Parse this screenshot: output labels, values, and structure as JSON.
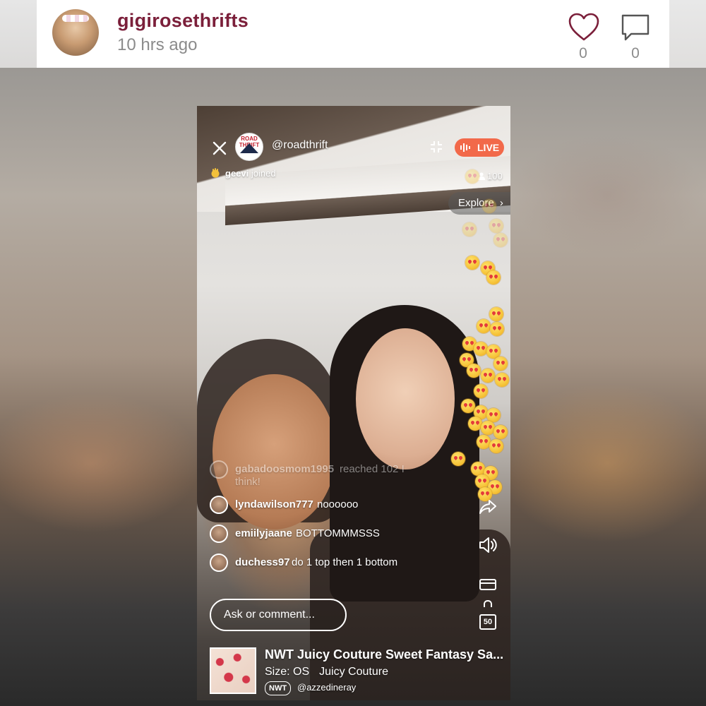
{
  "header": {
    "username": "gigirosethrifts",
    "timestamp": "10 hrs ago",
    "like_count": "0",
    "comment_count": "0"
  },
  "stream": {
    "channel_name": "@roadthrift",
    "channel_logo_text": "ROAD THRIFT",
    "live_label": "LIVE",
    "join_user": "geevi",
    "join_text": "joined",
    "viewer_count": "100",
    "explore_label": "Explore",
    "comments": [
      {
        "user": "gabadoosmom1995",
        "msg": "reached 102 I",
        "msg2": "think!",
        "faded": true
      },
      {
        "user": "lyndawilson777",
        "msg": "noooooo"
      },
      {
        "user": "emiilyjaane",
        "msg": "BOTTOMMMSSS"
      },
      {
        "user": "duchess97",
        "msg": "do 1 top then 1 bottom"
      }
    ],
    "ask_placeholder": "Ask or comment...",
    "listing_count": "50",
    "product": {
      "title": "NWT Juicy Couture Sweet Fantasy Sa...",
      "size": "Size: OS",
      "brand": "Juicy Couture",
      "badge": "NWT",
      "seller": "@azzedineray"
    }
  },
  "icons": [
    "heart-icon",
    "comment-icon",
    "close-icon",
    "collapse-icon",
    "live-bars-icon",
    "wave-icon",
    "person-icon",
    "chevron-right-icon",
    "share-icon",
    "speaker-icon",
    "card-icon",
    "bag-icon"
  ],
  "colors": {
    "username": "#7b1f3a",
    "live_badge": "#f2694a",
    "muted_text": "#8b8b8b"
  }
}
